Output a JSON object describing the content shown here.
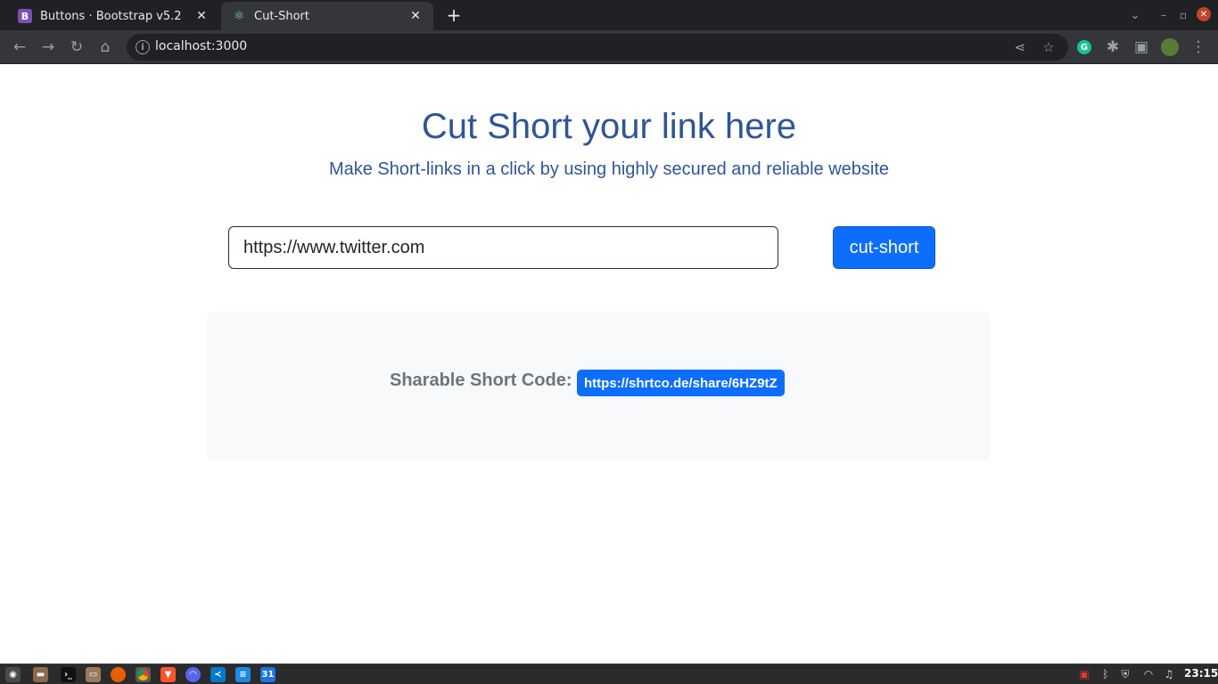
{
  "browser": {
    "tabs": [
      {
        "favicon": "B",
        "title": "Buttons · Bootstrap v5.2"
      },
      {
        "favicon": "react-icon",
        "title": "Cut-Short"
      }
    ],
    "address": "localhost:3000"
  },
  "page": {
    "title": "Cut Short your link here",
    "subtitle": "Make Short-links in a click by using highly secured and reliable website",
    "url_input": {
      "value": "https://www.twitter.com",
      "placeholder": ""
    },
    "cut_button": "cut-short",
    "result": {
      "label": "Sharable Short Code:",
      "link": "https://shrtco.de/share/6HZ9tZ"
    }
  },
  "taskbar": {
    "clock": "23:15"
  },
  "colors": {
    "heading": "#2f5597",
    "primary": "#0d6efd",
    "muted": "#6c757d",
    "result_bg": "#f8f9fa"
  }
}
